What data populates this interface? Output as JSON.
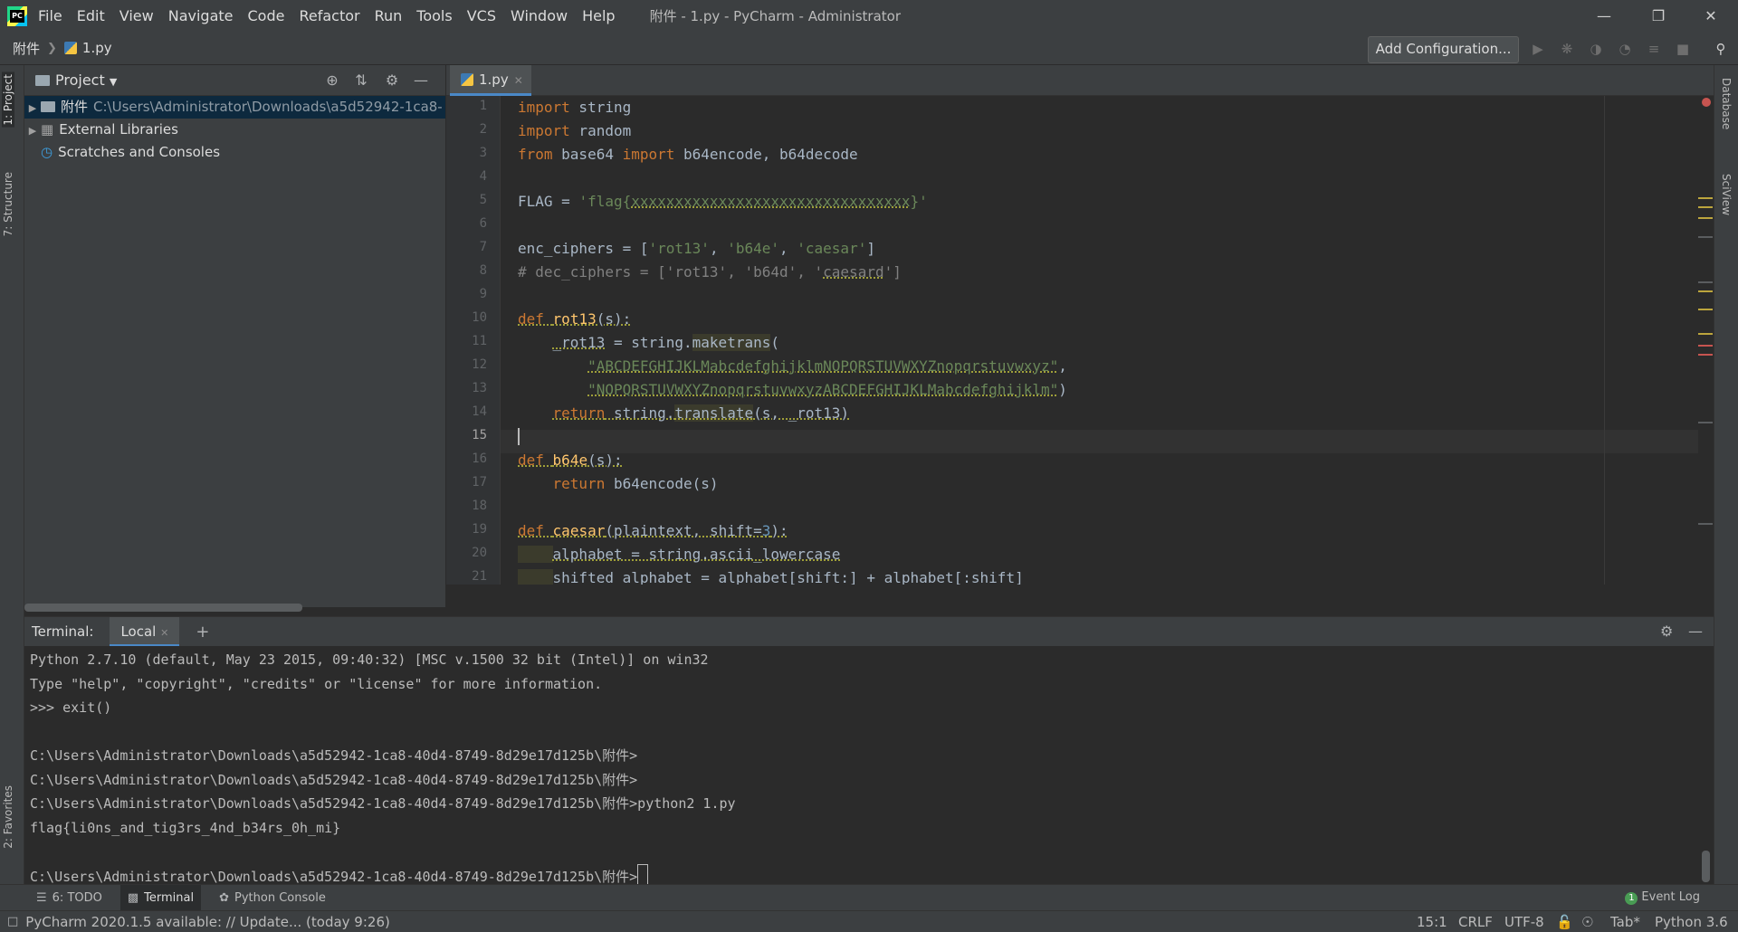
{
  "titlebar": {
    "menus": [
      "File",
      "Edit",
      "View",
      "Navigate",
      "Code",
      "Refactor",
      "Run",
      "Tools",
      "VCS",
      "Window",
      "Help"
    ],
    "window_title": "附件 - 1.py - PyCharm - Administrator"
  },
  "navbar": {
    "root": "附件",
    "file": "1.py",
    "add_configuration": "Add Configuration..."
  },
  "left_stripe": {
    "project_tab": "1: Project",
    "structure_tab": "7: Structure",
    "favorites_tab": "2: Favorites"
  },
  "right_stripe": {
    "database_tab": "Database",
    "sciview_tab": "SciView"
  },
  "project": {
    "title": "Project",
    "tree": [
      {
        "name": "附件",
        "path": "C:\\Users\\Administrator\\Downloads\\a5d52942-1ca8-",
        "selected": true
      },
      {
        "name": "External Libraries",
        "path": ""
      },
      {
        "name": "Scratches and Consoles",
        "path": ""
      }
    ]
  },
  "editor": {
    "tab": "1.py",
    "current_line": 15,
    "line_numbers": [
      "1",
      "2",
      "3",
      "4",
      "5",
      "6",
      "7",
      "8",
      "9",
      "10",
      "11",
      "12",
      "13",
      "14",
      "15",
      "16",
      "17",
      "18",
      "19",
      "20",
      "21"
    ]
  },
  "terminal": {
    "label": "Terminal:",
    "tab": "Local",
    "lines": [
      "Python 2.7.10 (default, May 23 2015, 09:40:32) [MSC v.1500 32 bit (Intel)] on win32",
      "Type \"help\", \"copyright\", \"credits\" or \"license\" for more information.",
      ">>> exit()",
      "",
      "C:\\Users\\Administrator\\Downloads\\a5d52942-1ca8-40d4-8749-8d29e17d125b\\附件>",
      "C:\\Users\\Administrator\\Downloads\\a5d52942-1ca8-40d4-8749-8d29e17d125b\\附件>",
      "C:\\Users\\Administrator\\Downloads\\a5d52942-1ca8-40d4-8749-8d29e17d125b\\附件>python2 1.py",
      "flag{li0ns_and_tig3rs_4nd_b34rs_0h_mi}",
      "",
      "C:\\Users\\Administrator\\Downloads\\a5d52942-1ca8-40d4-8749-8d29e17d125b\\附件>"
    ]
  },
  "bottom_tools": {
    "todo": "6: TODO",
    "terminal": "Terminal",
    "python_console": "Python Console",
    "event_log": "Event Log",
    "event_count": "1"
  },
  "statusbar": {
    "message": "PyCharm 2020.1.5 available: // Update... (today 9:26)",
    "position": "15:1",
    "line_sep": "CRLF",
    "encoding": "UTF-8",
    "indent": "Tab*",
    "interpreter": "Python 3.6"
  },
  "colors": {
    "accent": "#4a88c7",
    "keyword": "#cc7832",
    "string": "#6a8759",
    "function": "#ffc66d",
    "number": "#6897bb"
  }
}
